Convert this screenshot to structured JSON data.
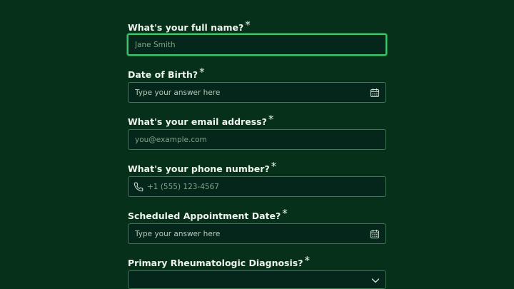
{
  "form": {
    "fields": [
      {
        "label": "What's your full name?",
        "required_mark": "*",
        "placeholder": "Jane Smith",
        "icon": ""
      },
      {
        "label": "Date of Birth?",
        "required_mark": "*",
        "placeholder": "Type your answer here",
        "icon": "calendar-icon"
      },
      {
        "label": "What's your email address?",
        "required_mark": "*",
        "placeholder": "you@example.com",
        "icon": ""
      },
      {
        "label": "What's your phone number?",
        "required_mark": "*",
        "placeholder": "+1 (555) 123-4567",
        "icon": "phone-icon"
      },
      {
        "label": "Scheduled Appointment Date?",
        "required_mark": "*",
        "placeholder": "Type your answer here",
        "icon": "calendar-icon"
      },
      {
        "label": "Primary Rheumatologic Diagnosis?",
        "required_mark": "*",
        "selected_value": "",
        "icon": "chevron-down-icon"
      }
    ]
  },
  "colors": {
    "background": "#06301a",
    "field_background": "#05261a",
    "border": "#3f7a52",
    "focus_border": "#3fc369",
    "text": "#eef4ee"
  }
}
